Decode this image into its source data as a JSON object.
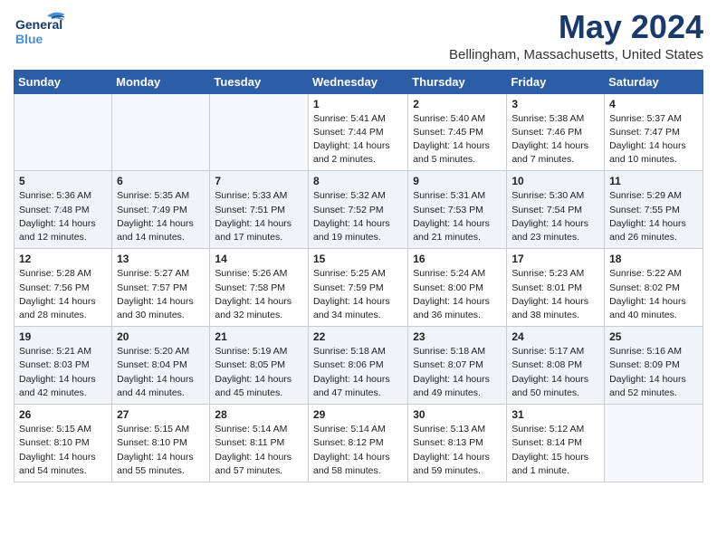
{
  "header": {
    "logo_line1": "General",
    "logo_line2": "Blue",
    "month": "May 2024",
    "location": "Bellingham, Massachusetts, United States"
  },
  "weekdays": [
    "Sunday",
    "Monday",
    "Tuesday",
    "Wednesday",
    "Thursday",
    "Friday",
    "Saturday"
  ],
  "weeks": [
    [
      {
        "day": "",
        "info": ""
      },
      {
        "day": "",
        "info": ""
      },
      {
        "day": "",
        "info": ""
      },
      {
        "day": "1",
        "info": "Sunrise: 5:41 AM\nSunset: 7:44 PM\nDaylight: 14 hours\nand 2 minutes."
      },
      {
        "day": "2",
        "info": "Sunrise: 5:40 AM\nSunset: 7:45 PM\nDaylight: 14 hours\nand 5 minutes."
      },
      {
        "day": "3",
        "info": "Sunrise: 5:38 AM\nSunset: 7:46 PM\nDaylight: 14 hours\nand 7 minutes."
      },
      {
        "day": "4",
        "info": "Sunrise: 5:37 AM\nSunset: 7:47 PM\nDaylight: 14 hours\nand 10 minutes."
      }
    ],
    [
      {
        "day": "5",
        "info": "Sunrise: 5:36 AM\nSunset: 7:48 PM\nDaylight: 14 hours\nand 12 minutes."
      },
      {
        "day": "6",
        "info": "Sunrise: 5:35 AM\nSunset: 7:49 PM\nDaylight: 14 hours\nand 14 minutes."
      },
      {
        "day": "7",
        "info": "Sunrise: 5:33 AM\nSunset: 7:51 PM\nDaylight: 14 hours\nand 17 minutes."
      },
      {
        "day": "8",
        "info": "Sunrise: 5:32 AM\nSunset: 7:52 PM\nDaylight: 14 hours\nand 19 minutes."
      },
      {
        "day": "9",
        "info": "Sunrise: 5:31 AM\nSunset: 7:53 PM\nDaylight: 14 hours\nand 21 minutes."
      },
      {
        "day": "10",
        "info": "Sunrise: 5:30 AM\nSunset: 7:54 PM\nDaylight: 14 hours\nand 23 minutes."
      },
      {
        "day": "11",
        "info": "Sunrise: 5:29 AM\nSunset: 7:55 PM\nDaylight: 14 hours\nand 26 minutes."
      }
    ],
    [
      {
        "day": "12",
        "info": "Sunrise: 5:28 AM\nSunset: 7:56 PM\nDaylight: 14 hours\nand 28 minutes."
      },
      {
        "day": "13",
        "info": "Sunrise: 5:27 AM\nSunset: 7:57 PM\nDaylight: 14 hours\nand 30 minutes."
      },
      {
        "day": "14",
        "info": "Sunrise: 5:26 AM\nSunset: 7:58 PM\nDaylight: 14 hours\nand 32 minutes."
      },
      {
        "day": "15",
        "info": "Sunrise: 5:25 AM\nSunset: 7:59 PM\nDaylight: 14 hours\nand 34 minutes."
      },
      {
        "day": "16",
        "info": "Sunrise: 5:24 AM\nSunset: 8:00 PM\nDaylight: 14 hours\nand 36 minutes."
      },
      {
        "day": "17",
        "info": "Sunrise: 5:23 AM\nSunset: 8:01 PM\nDaylight: 14 hours\nand 38 minutes."
      },
      {
        "day": "18",
        "info": "Sunrise: 5:22 AM\nSunset: 8:02 PM\nDaylight: 14 hours\nand 40 minutes."
      }
    ],
    [
      {
        "day": "19",
        "info": "Sunrise: 5:21 AM\nSunset: 8:03 PM\nDaylight: 14 hours\nand 42 minutes."
      },
      {
        "day": "20",
        "info": "Sunrise: 5:20 AM\nSunset: 8:04 PM\nDaylight: 14 hours\nand 44 minutes."
      },
      {
        "day": "21",
        "info": "Sunrise: 5:19 AM\nSunset: 8:05 PM\nDaylight: 14 hours\nand 45 minutes."
      },
      {
        "day": "22",
        "info": "Sunrise: 5:18 AM\nSunset: 8:06 PM\nDaylight: 14 hours\nand 47 minutes."
      },
      {
        "day": "23",
        "info": "Sunrise: 5:18 AM\nSunset: 8:07 PM\nDaylight: 14 hours\nand 49 minutes."
      },
      {
        "day": "24",
        "info": "Sunrise: 5:17 AM\nSunset: 8:08 PM\nDaylight: 14 hours\nand 50 minutes."
      },
      {
        "day": "25",
        "info": "Sunrise: 5:16 AM\nSunset: 8:09 PM\nDaylight: 14 hours\nand 52 minutes."
      }
    ],
    [
      {
        "day": "26",
        "info": "Sunrise: 5:15 AM\nSunset: 8:10 PM\nDaylight: 14 hours\nand 54 minutes."
      },
      {
        "day": "27",
        "info": "Sunrise: 5:15 AM\nSunset: 8:10 PM\nDaylight: 14 hours\nand 55 minutes."
      },
      {
        "day": "28",
        "info": "Sunrise: 5:14 AM\nSunset: 8:11 PM\nDaylight: 14 hours\nand 57 minutes."
      },
      {
        "day": "29",
        "info": "Sunrise: 5:14 AM\nSunset: 8:12 PM\nDaylight: 14 hours\nand 58 minutes."
      },
      {
        "day": "30",
        "info": "Sunrise: 5:13 AM\nSunset: 8:13 PM\nDaylight: 14 hours\nand 59 minutes."
      },
      {
        "day": "31",
        "info": "Sunrise: 5:12 AM\nSunset: 8:14 PM\nDaylight: 15 hours\nand 1 minute."
      },
      {
        "day": "",
        "info": ""
      }
    ]
  ]
}
